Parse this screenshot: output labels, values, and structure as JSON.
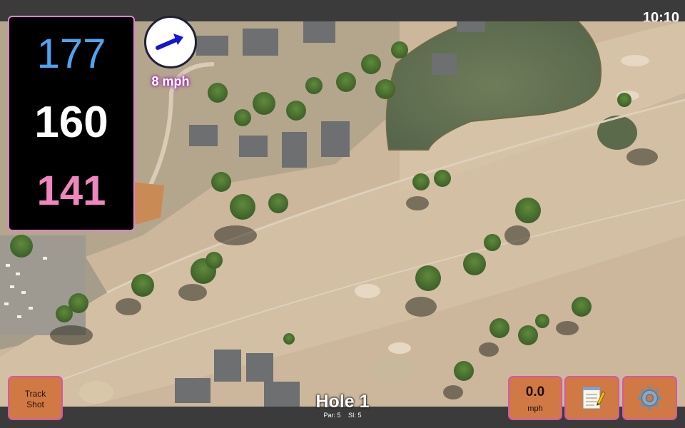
{
  "status_bar": {
    "time": "10:10"
  },
  "distances": {
    "back": "177",
    "center": "160",
    "front": "141"
  },
  "wind": {
    "speed_label": "8 mph"
  },
  "buttons": {
    "track_shot_line1": "Track",
    "track_shot_line2": "Shot",
    "wind_speed_value": "0.0",
    "wind_speed_unit": "mph"
  },
  "hole": {
    "title": "Hole 1",
    "par": "Par: 5",
    "si": "SI: 5"
  },
  "icons": {
    "wind": "wind-arrow-icon",
    "notes": "notepad-icon",
    "settings": "gear-icon"
  },
  "colors": {
    "back": "#4fa3f2",
    "center": "#ffffff",
    "front": "#ef86be",
    "button": "#d07944",
    "button_border": "#d15aa8"
  }
}
